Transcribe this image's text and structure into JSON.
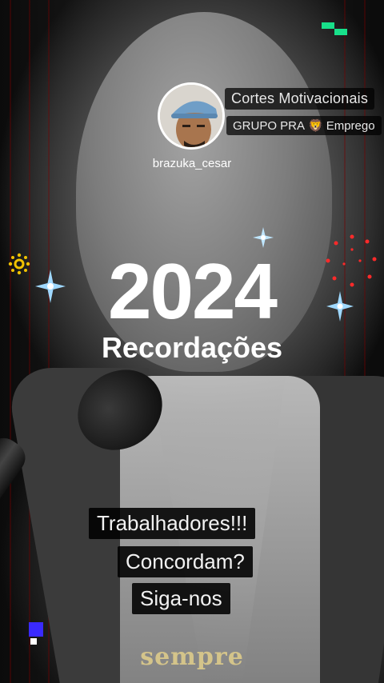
{
  "profile": {
    "username": "brazuka_cesar",
    "channel_line1": "Cortes Motivacionais",
    "channel_line2_a": "GRUPO PRA",
    "channel_line2_emoji": "🦁",
    "channel_line2_b": "Emprego"
  },
  "headline": {
    "year": "2024",
    "subtitle": "Recordações"
  },
  "captions": [
    "Trabalhadores!!!",
    "Concordam?",
    "Siga-nos"
  ],
  "subtitle_word": "sempre",
  "colors": {
    "sparkle": "#9fd8ff",
    "fireworks_red": "#ff2a2a",
    "sunburst_yellow": "#f2c200",
    "pixel_green": "#18e08a",
    "pixel_blue": "#3a2aff",
    "caption_bg": "#000000",
    "sempre_text": "#d4c48a"
  },
  "icons": [
    "sparkle-icon",
    "fireworks-icon",
    "sunburst-icon",
    "pixel-decoration-icon",
    "lion-emoji-icon"
  ]
}
